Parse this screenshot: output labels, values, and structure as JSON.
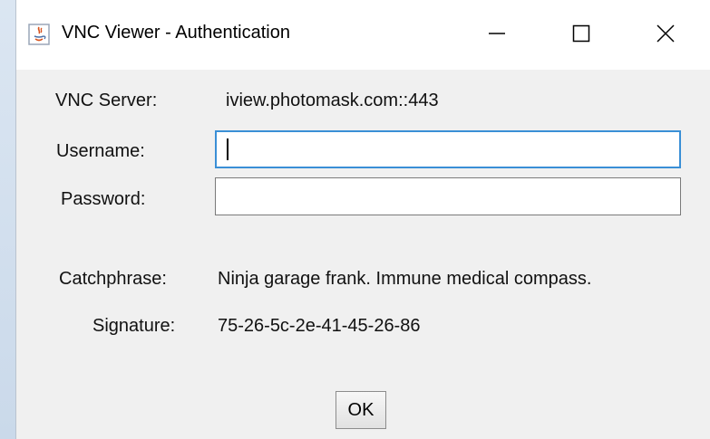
{
  "window": {
    "title": "VNC Viewer - Authentication",
    "controls": {
      "minimize_icon": "minimize-icon",
      "maximize_icon": "maximize-icon",
      "close_icon": "close-icon"
    }
  },
  "form": {
    "server": {
      "label": "VNC Server:",
      "value": "iview.photomask.com::443"
    },
    "username": {
      "label": "Username:",
      "value": ""
    },
    "password": {
      "label": "Password:",
      "value": ""
    },
    "catchphrase": {
      "label": "Catchphrase:",
      "value": "Ninja garage frank. Immune medical compass."
    },
    "signature": {
      "label": "Signature:",
      "value": "75-26-5c-2e-41-45-26-86"
    }
  },
  "buttons": {
    "ok_label": "OK"
  },
  "colors": {
    "focus_border": "#3a8fd6",
    "window_bg": "#f0f0f0",
    "desktop_bg": "#dbe6f2"
  }
}
